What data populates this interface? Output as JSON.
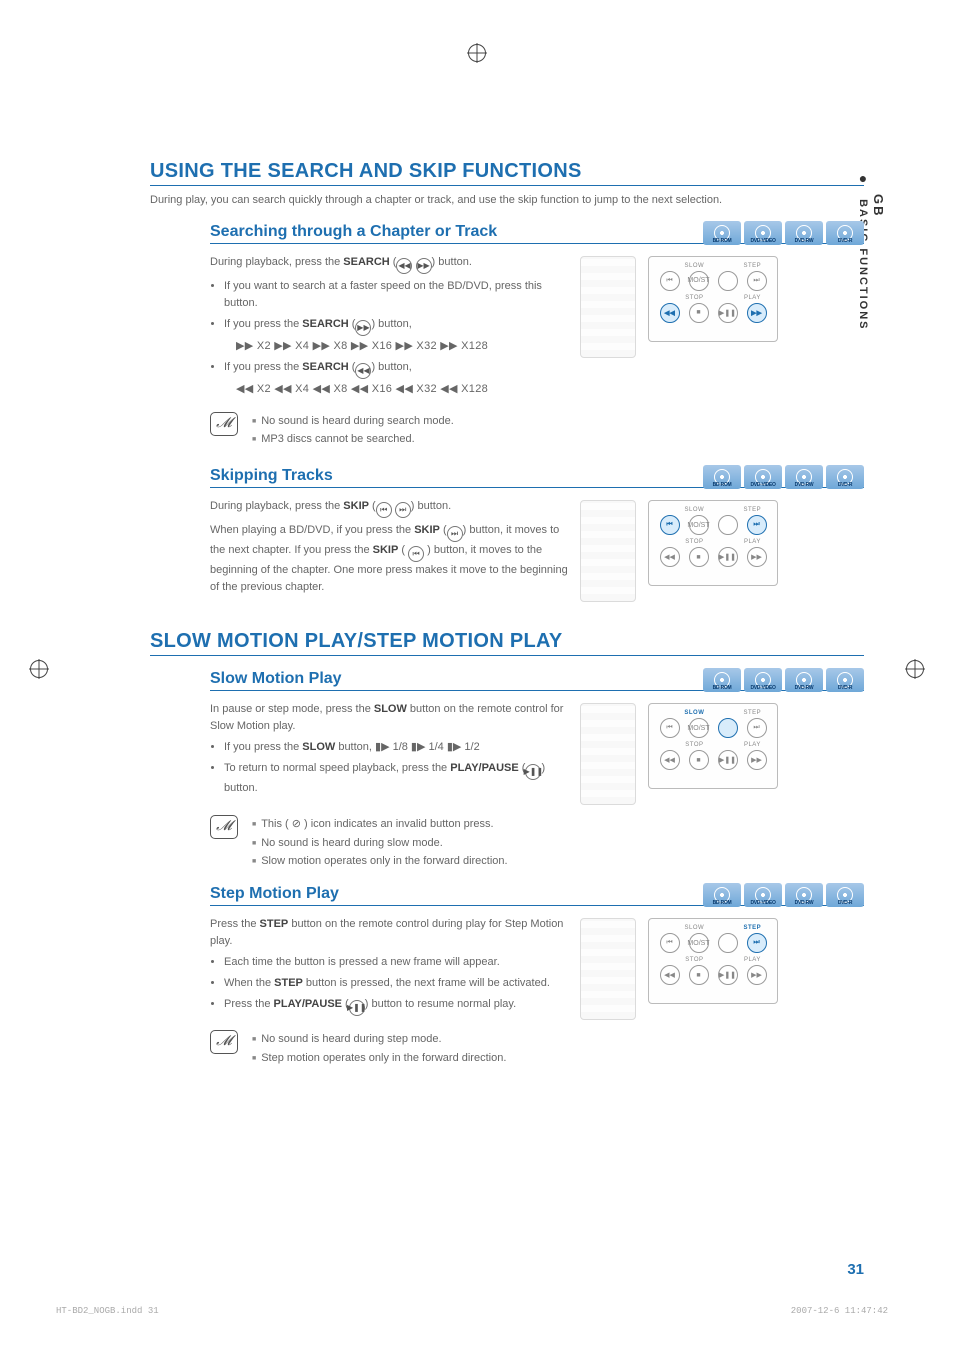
{
  "side": {
    "lang": "GB",
    "section": "BASIC FUNCTIONS"
  },
  "h1a": "USING THE SEARCH AND SKIP FUNCTIONS",
  "intro1": "During play, you can search quickly through a chapter or track, and use the skip function to jump to the next selection.",
  "discs": [
    "BD-ROM",
    "DVD-VIDEO",
    "DVD-RW",
    "DVD-R"
  ],
  "search": {
    "head": "Searching through a Chapter or Track",
    "p1a": "During playback, press the ",
    "p1b": "SEARCH",
    "p1c": " button.",
    "b1": "If you want to search at a faster speed on the BD/DVD, press this button.",
    "b2a": "If you press the ",
    "b2b": "SEARCH",
    "b2c": " button,",
    "line_fwd": "▶▶ X2 ▶▶ X4 ▶▶ X8 ▶▶ X16 ▶▶ X32 ▶▶ X128",
    "b3a": "If you press the ",
    "b3b": "SEARCH",
    "b3c": " button,",
    "line_rew": "◀◀ X2 ◀◀ X4 ◀◀ X8 ◀◀ X16 ◀◀ X32 ◀◀ X128",
    "note1": "No sound is heard during search mode.",
    "note2": "MP3 discs cannot be searched."
  },
  "skip": {
    "head": "Skipping Tracks",
    "p1a": "During playback, press the ",
    "p1b": "SKIP",
    "p1c": " button.",
    "p2a": "When playing a BD/DVD, if you press the ",
    "p2b": "SKIP",
    "p2c": " button, it moves to the next chapter. If you press the ",
    "p2d": "SKIP",
    "p2e": " button, it moves to the beginning of the chapter. One more press makes it move to the beginning of the previous chapter."
  },
  "h1b": "SLOW MOTION PLAY/STEP MOTION PLAY",
  "slow": {
    "head": "Slow Motion Play",
    "p1a": "In pause or step mode, press the ",
    "p1b": "SLOW",
    "p1c": " button on the remote control for Slow Motion play.",
    "b1a": "If you press the ",
    "b1b": "SLOW",
    "b1c": " button, ▮▶ 1/8 ▮▶ 1/4 ▮▶ 1/2",
    "b2a": "To return to normal speed playback, press the ",
    "b2b": "PLAY/PAUSE",
    "b2c": " button.",
    "note1": "This ( ⊘ ) icon indicates an invalid button press.",
    "note2": "No sound is heard during slow mode.",
    "note3": "Slow motion operates only in the forward direction."
  },
  "step": {
    "head": "Step Motion Play",
    "p1a": "Press the ",
    "p1b": "STEP",
    "p1c": " button on the remote control during play for Step Motion play.",
    "b1": "Each time the button is pressed a new frame will appear.",
    "b2a": "When the ",
    "b2b": "STEP",
    "b2c": " button is pressed, the next frame will be activated.",
    "b3a": "Press the ",
    "b3b": "PLAY/PAUSE",
    "b3c": " button to resume normal play.",
    "note1": "No sound is heard during step mode.",
    "note2": "Step motion operates only in the forward direction."
  },
  "panel": {
    "labels": {
      "slow": "SLOW",
      "step": "STEP",
      "stop": "STOP",
      "play": "PLAY",
      "most": "MO/ST"
    },
    "glyphs": {
      "skipb": "⏮",
      "skipf": "⏭",
      "rew": "◀◀",
      "stop": "■",
      "play": "▶❚❚",
      "fwd": "▶▶"
    }
  },
  "page_number": "31",
  "footer": {
    "file": "HT-BD2_NOGB.indd   31",
    "date": "2007-12-6   11:47:42"
  }
}
